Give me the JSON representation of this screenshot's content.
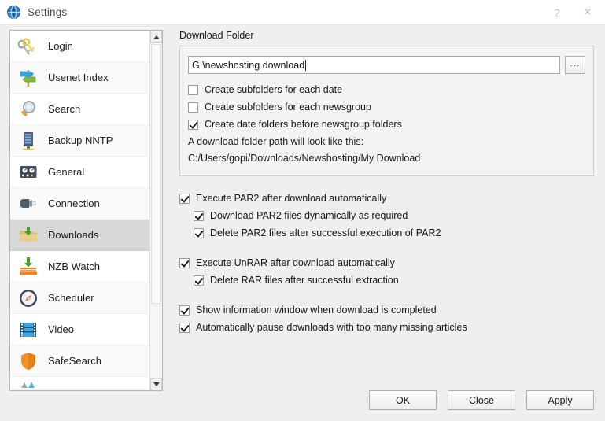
{
  "window": {
    "title": "Settings",
    "icon": "globe-icon",
    "help_label": "?",
    "close_label": "×"
  },
  "sidebar": {
    "items": [
      {
        "label": "Login",
        "icon": "keys-icon",
        "selected": false
      },
      {
        "label": "Usenet Index",
        "icon": "signpost-icon",
        "selected": false
      },
      {
        "label": "Search",
        "icon": "magnifier-icon",
        "selected": false
      },
      {
        "label": "Backup NNTP",
        "icon": "server-icon",
        "selected": false
      },
      {
        "label": "General",
        "icon": "gauges-icon",
        "selected": false
      },
      {
        "label": "Connection",
        "icon": "plug-icon",
        "selected": false
      },
      {
        "label": "Downloads",
        "icon": "download-folder-icon",
        "selected": true
      },
      {
        "label": "NZB Watch",
        "icon": "nzb-watch-icon",
        "selected": false
      },
      {
        "label": "Scheduler",
        "icon": "compass-icon",
        "selected": false
      },
      {
        "label": "Video",
        "icon": "film-strip-icon",
        "selected": false
      },
      {
        "label": "SafeSearch",
        "icon": "shield-icon",
        "selected": false
      }
    ]
  },
  "download_folder": {
    "group_title": "Download Folder",
    "path_value": "G:\\newshosting download",
    "path_placeholder": "",
    "browse_label": "...",
    "checkboxes": [
      {
        "label": "Create subfolders for each date",
        "checked": false
      },
      {
        "label": "Create subfolders for each newsgroup",
        "checked": false
      },
      {
        "label": "Create date folders before newsgroup folders",
        "checked": true
      }
    ],
    "hint_line1": "A download folder path will look like this:",
    "hint_line2": "C:/Users/gopi/Downloads/Newshosting/My Download"
  },
  "options": {
    "par2_main": {
      "label": "Execute PAR2 after download automatically",
      "checked": true
    },
    "par2_sub1": {
      "label": "Download PAR2 files dynamically as required",
      "checked": true
    },
    "par2_sub2": {
      "label": "Delete PAR2 files after successful execution of PAR2",
      "checked": true
    },
    "unrar_main": {
      "label": "Execute UnRAR after download automatically",
      "checked": true
    },
    "unrar_sub1": {
      "label": "Delete RAR files after successful extraction",
      "checked": true
    },
    "info_window": {
      "label": "Show information window when download is completed",
      "checked": true
    },
    "auto_pause": {
      "label": "Automatically pause downloads with too many missing articles",
      "checked": true
    }
  },
  "footer": {
    "ok_label": "OK",
    "close_label": "Close",
    "apply_label": "Apply"
  }
}
